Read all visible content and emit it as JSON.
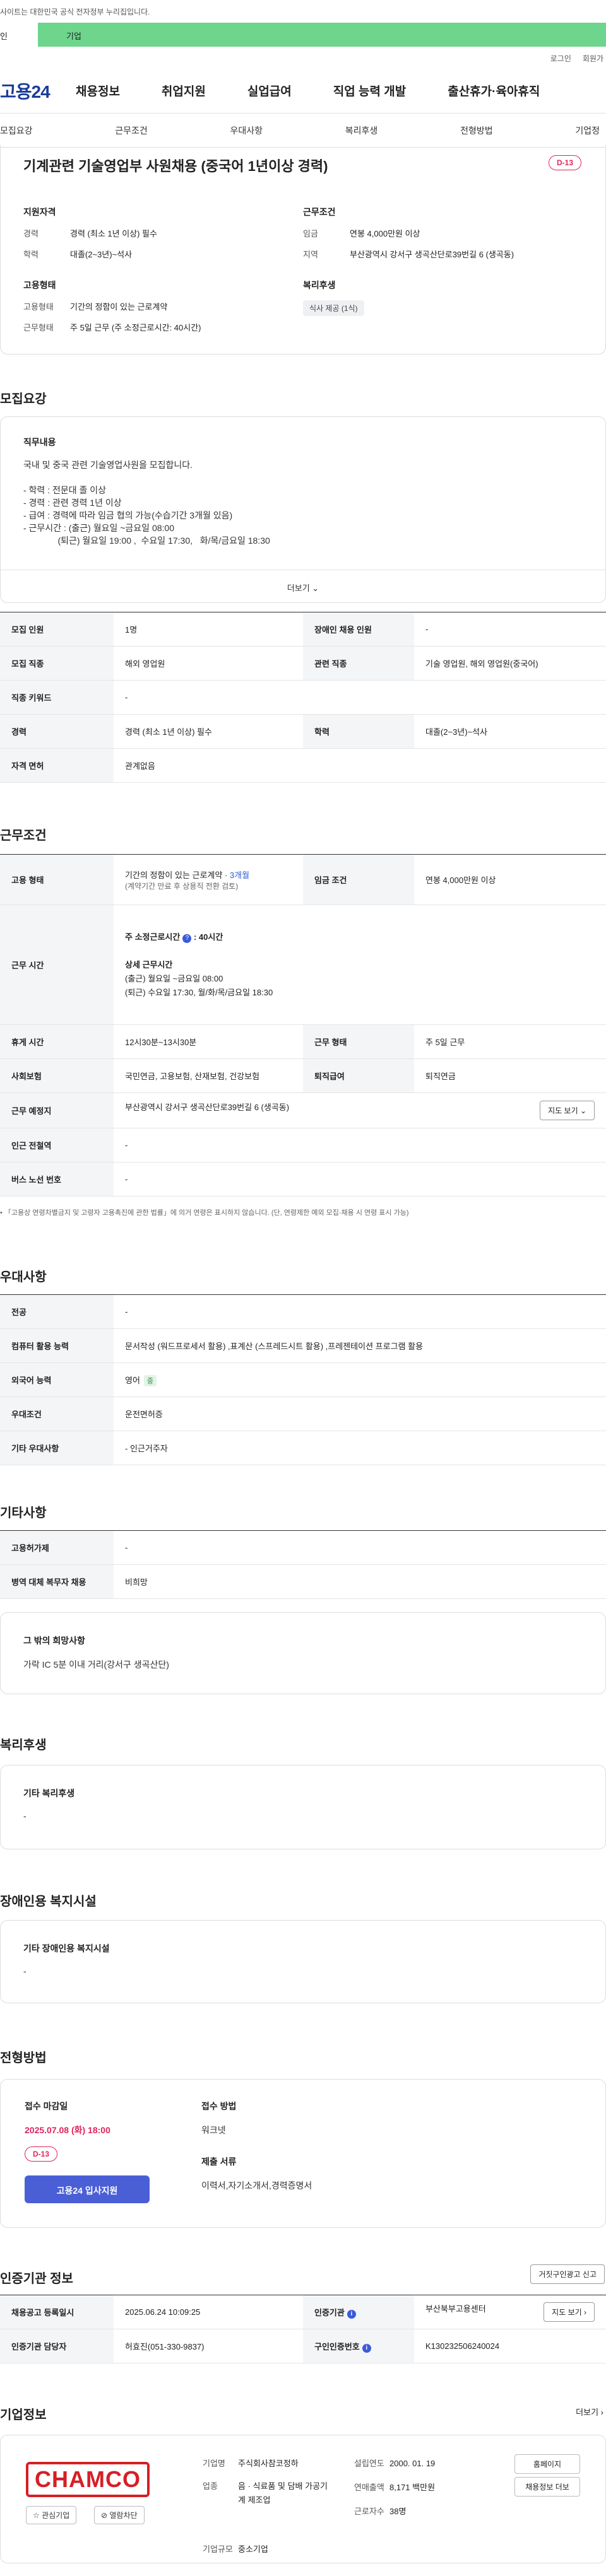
{
  "gov_notice": "사이트는 대한민국 공식 전자정부 누리집입니다.",
  "site_tabs": [
    "인",
    "기업"
  ],
  "util_links": [
    "로그인",
    "회원가"
  ],
  "logo": "고용24",
  "gnb": [
    "채용정보",
    "취업지원",
    "실업급여",
    "직업 능력 개발",
    "출산휴가·육아휴직"
  ],
  "subnav": [
    "모집요강",
    "근무조건",
    "우대사항",
    "복리후생",
    "전형방법",
    "기업정"
  ],
  "summary": {
    "title": "기계관련 기술영업부 사원채용 (중국어 1년이상 경력)",
    "dday": "D-13",
    "qual_h": "지원자격",
    "career_k": "경력",
    "career_v": "경력 (최소 1년 이상) 필수",
    "edu_k": "학력",
    "edu_v": "대졸(2~3년)~석사",
    "work_h": "근무조건",
    "wage_k": "임금",
    "wage_v": "연봉 4,000만원 이상",
    "region_k": "지역",
    "region_v": "부산광역시 강서구 생곡산단로39번길 6 (생곡동)",
    "emp_h": "고용형태",
    "type_k": "고용형태",
    "type_v": "기간의 정함이 있는 근로계약",
    "hours_k": "근무형태",
    "hours_v": "주 5일 근무 (주 소정근로시간: 40시간)",
    "welfare_h": "복리후생",
    "welfare_chip": "식사 제공 (1식)"
  },
  "sections": {
    "recruit": "모집요강",
    "work": "근무조건",
    "pref": "우대사항",
    "etc": "기타사항",
    "welfare": "복리후생",
    "disabled": "장애인용 복지시설",
    "apply": "전형방법",
    "agency": "인증기관 정보",
    "company": "기업정보"
  },
  "job": {
    "h": "직무내용",
    "body": "국내 및 중국 관련 기술영업사원을 모집합니다.\n\n- 학력 : 전문대 졸 이상\n- 경력 : 관련 경력 1년 이상\n- 급여 : 경력에 따라 임금 협의 가능(수습기간 3개월 있음)\n- 근무시간 : (출근) 월요일 ~금요일 08:00\n              (퇴근) 월요일 19:00 ,  수요일 17:30,   화/목/금요일 18:30",
    "more": "더보기 ⌄"
  },
  "recruit_table": {
    "count_k": "모집 인원",
    "count_v": "1명",
    "dis_k": "장애인 채용 인원",
    "dis_v": "-",
    "job_k": "모집 직종",
    "job_v": "해외 영업원",
    "rel_k": "관련 직종",
    "rel_v": "기술 영업원, 해외 영업원(중국어)",
    "kw_k": "직종 키워드",
    "kw_v": "-",
    "car_k": "경력",
    "car_v": "경력 (최소 1년 이상) 필수",
    "edu_k": "학력",
    "edu_v": "대졸(2~3년)~석사",
    "lic_k": "자격 면허",
    "lic_v": "관계없음"
  },
  "work_table": {
    "type_k": "고용 형태",
    "type_v1": "기간의 정함이 있는 근로계약 · ",
    "type_v1b": "3개월",
    "type_v2": "(계약기간 만료 후 상용직 전환 검토)",
    "wage_k": "임금 조건",
    "wage_v": "연봉 4,000만원 이상",
    "time_k": "근무 시간",
    "time_h1": "주 소정근로시간",
    "time_q": "?",
    "time_h1b": ": 40시간",
    "time_h2": "상세 근무시간",
    "time_l1": "(출근) 월요일 ~금요일 08:00",
    "time_l2": "(퇴근) 수요일 17:30,   월/화/목/금요일 18:30",
    "rest_k": "휴게 시간",
    "rest_v": "12시30분~13시30분",
    "form_k": "근무 형태",
    "form_v": "주 5일 근무",
    "ins_k": "사회보험",
    "ins_v": "국민연금, 고용보험, 산재보험, 건강보험",
    "ret_k": "퇴직급여",
    "ret_v": "퇴직연금",
    "loc_k": "근무 예정지",
    "loc_v": "부산광역시 강서구 생곡산단로39번길 6 (생곡동)",
    "map_btn": "지도 보기 ⌄",
    "sub_k": "인근 전철역",
    "sub_v": "-",
    "bus_k": "버스 노선 번호",
    "bus_v": "-"
  },
  "work_note": "• 「고용상 연령차별금지 및 고령자 고용촉진에 관한 법률」에 의거 연령은 표시하지 않습니다. (단, 연령제한 예외 모집·채용 시 연령 표시 가능)",
  "pref_table": {
    "major_k": "전공",
    "major_v": "-",
    "pc_k": "컴퓨터 활용 능력",
    "pc_v": "문서작성 (워드프로세서 활용) ,표계산 (스프레드시트 활용) ,프레젠테이션 프로그램 활용",
    "lang_k": "외국어 능력",
    "lang_v": "영어",
    "lang_badge": "중",
    "pref_k": "우대조건",
    "pref_v": "운전면허증",
    "etc_k": "기타 우대사항",
    "etc_v": "- 인근거주자"
  },
  "etc_table": {
    "rehire_k": "고용허가제",
    "rehire_v": "-",
    "mil_k": "병역 대체 복무자 채용",
    "mil_v": "비희망"
  },
  "etc_box": {
    "h": "그 밖의 희망사항",
    "v": "가락 IC 5분 이내 거리(강서구 생곡산단)"
  },
  "welfare_box": {
    "h": "기타 복리후생",
    "v": "-"
  },
  "disabled_box": {
    "h": "기타 장애인용 복지시설",
    "v": "-"
  },
  "apply": {
    "deadline_h": "접수 마감일",
    "deadline_v": "2025.07.08 (화) 18:00",
    "dday": "D-13",
    "btn": "고용24 입사지원",
    "method_h": "접수 방법",
    "method_v": "워크넷",
    "docs_h": "제출 서류",
    "docs_v": "이력서,자기소개서,경력증명서"
  },
  "agency": {
    "report_btn": "거짓구인광고 신고",
    "reg_k": "채용공고 등록일시",
    "reg_v": "2025.06.24 10:09:25",
    "org_k": "인증기관",
    "org_v": "부산북부고용센터",
    "map_btn": "지도 보기 ›",
    "mgr_k": "인증기관 담당자",
    "mgr_v": "허효진(051-330-9837)",
    "id_k": "구인인증번호",
    "id_v": "K130232506240024"
  },
  "company": {
    "more": "더보기 ›",
    "logo_text": "CHAMCO",
    "fav": "☆ 관심기업",
    "block": "⊘ 열람차단",
    "name_k": "기업명",
    "name_v": "주식회사참코정하",
    "biz_k": "업종",
    "biz_v": "음 · 식료품 및 담배 가공기계 제조업",
    "size_k": "기업규모",
    "size_v": "중소기업",
    "est_k": "설립연도",
    "est_v": "2000. 01. 19",
    "rev_k": "연매출액",
    "rev_v": "8,171 백만원",
    "emp_k": "근로자수",
    "emp_v": "38명",
    "home_btn": "홈페이지",
    "jobs_btn": "채용정보 더보"
  }
}
